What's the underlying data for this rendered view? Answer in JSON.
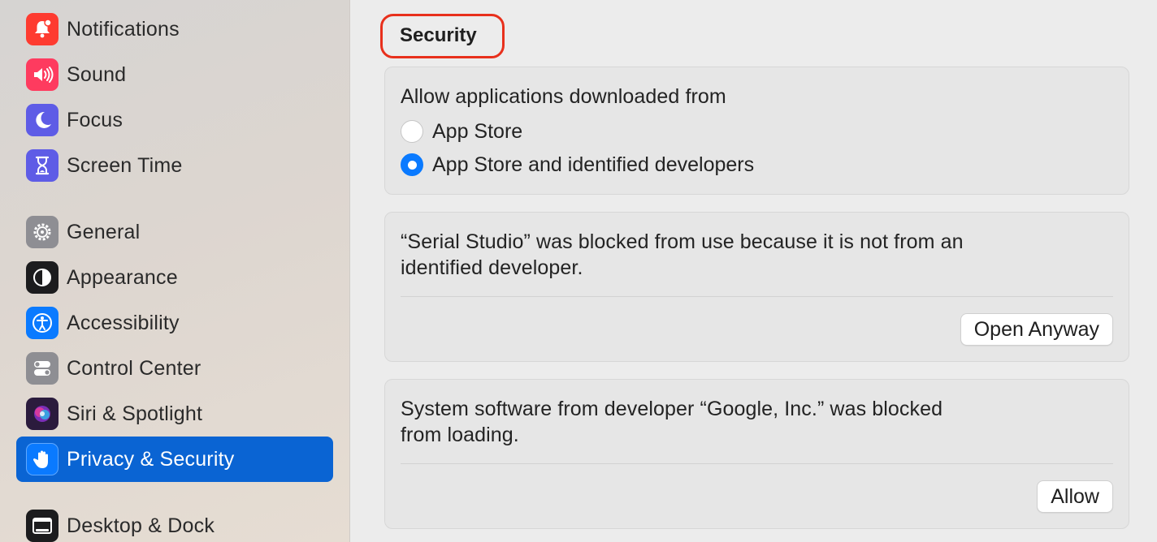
{
  "sidebar": {
    "items": [
      {
        "label": "Notifications",
        "icon": "bell-icon",
        "color": "#fe3b30"
      },
      {
        "label": "Sound",
        "icon": "speaker-icon",
        "color": "#fe3b5f"
      },
      {
        "label": "Focus",
        "icon": "moon-icon",
        "color": "#5e5ce6"
      },
      {
        "label": "Screen Time",
        "icon": "hourglass-icon",
        "color": "#5e5ce6"
      },
      {
        "label": "General",
        "icon": "gear-icon",
        "color": "#8e8e93"
      },
      {
        "label": "Appearance",
        "icon": "appearance-icon",
        "color": "#1c1c1e"
      },
      {
        "label": "Accessibility",
        "icon": "accessibility-icon",
        "color": "#0a7aff"
      },
      {
        "label": "Control Center",
        "icon": "toggles-icon",
        "color": "#8e8e93"
      },
      {
        "label": "Siri & Spotlight",
        "icon": "siri-icon",
        "color": "#2b1b3d"
      },
      {
        "label": "Privacy & Security",
        "icon": "hand-icon",
        "color": "#0a7aff",
        "selected": true
      },
      {
        "label": "Desktop & Dock",
        "icon": "dock-icon",
        "color": "#1c1c1e"
      }
    ]
  },
  "main": {
    "section_title": "Security",
    "downloads": {
      "heading": "Allow applications downloaded from",
      "options": [
        {
          "label": "App Store",
          "selected": false
        },
        {
          "label": "App Store and identified developers",
          "selected": true
        }
      ]
    },
    "blocked_app": {
      "message_line1": "“Serial Studio” was blocked from use because it is not from an",
      "message_line2": "identified developer.",
      "button": "Open Anyway"
    },
    "blocked_software": {
      "message_line1": "System software from developer “Google, Inc.” was blocked",
      "message_line2": "from loading.",
      "button": "Allow"
    }
  },
  "colors": {
    "accent": "#0a64d3",
    "highlight_ring": "#e8301c"
  }
}
